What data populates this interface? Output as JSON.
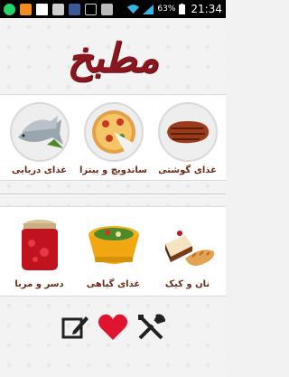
{
  "status_bar": {
    "time": "21:34",
    "battery_percent": "63%",
    "icons": [
      "whatsapp-icon",
      "rss-icon",
      "envelope-icon",
      "screenshot-icon",
      "facebook-icon",
      "usb-icon",
      "shield-icon",
      "wifi-icon",
      "signal-icon",
      "battery-icon"
    ]
  },
  "app": {
    "title": "مطبخ",
    "title_color": "#8a1620"
  },
  "categories_row1": [
    {
      "label": "غذای دریایی",
      "icon": "fish-icon"
    },
    {
      "label": "ساندویچ و پیتزا",
      "icon": "pizza-icon"
    },
    {
      "label": "غذای گوشتی",
      "icon": "steak-icon"
    }
  ],
  "categories_row2": [
    {
      "label": "دسر و مربا",
      "icon": "jam-jar-icon"
    },
    {
      "label": "غذای گیاهی",
      "icon": "salad-bowl-icon"
    },
    {
      "label": "نان و کیک",
      "icon": "bread-cake-icon"
    }
  ],
  "toolbar": {
    "icons": [
      "edit-icon",
      "heart-icon",
      "tools-icon"
    ],
    "heart_color": "#e0142e"
  }
}
